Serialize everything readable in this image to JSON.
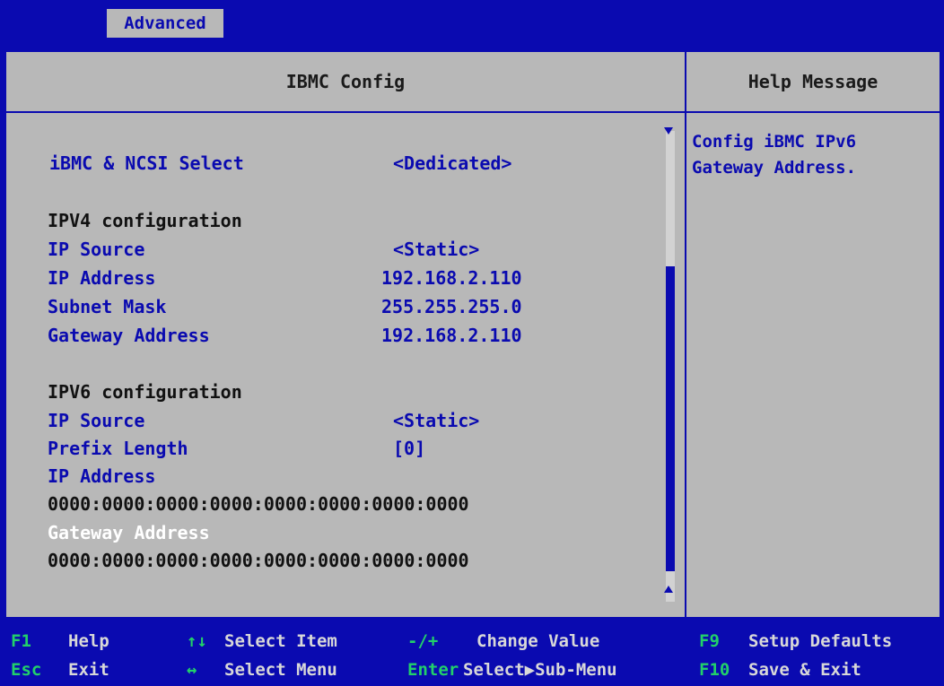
{
  "topbar": {
    "active_tab": "Advanced"
  },
  "panel": {
    "title": "IBMC Config",
    "help_title": "Help Message"
  },
  "items": [
    {
      "label": "iBMC & NCSI Select",
      "value": "<Dedicated>"
    },
    {
      "label": "IPV4 configuration",
      "value": ""
    },
    {
      "label": "IP Source",
      "value": "<Static>"
    },
    {
      "label": "IP Address",
      "value": "192.168.2.110"
    },
    {
      "label": "Subnet Mask",
      "value": "255.255.255.0"
    },
    {
      "label": "Gateway Address",
      "value": "192.168.2.110"
    },
    {
      "label": "IPV6 configuration",
      "value": ""
    },
    {
      "label": "IP Source",
      "value": "<Static>"
    },
    {
      "label": "Prefix Length",
      "value": "[0]"
    },
    {
      "label": "IP Address",
      "value": ""
    },
    {
      "label": "0000:0000:0000:0000:0000:0000:0000:0000",
      "value": ""
    },
    {
      "label": "Gateway Address",
      "value": ""
    },
    {
      "label": "0000:0000:0000:0000:0000:0000:0000:0000",
      "value": ""
    }
  ],
  "help": {
    "text": "Config iBMC IPv6\nGateway Address."
  },
  "footer": {
    "keys": [
      {
        "key": "F1",
        "desc": "Help"
      },
      {
        "key": "Esc",
        "desc": "Exit"
      },
      {
        "key": "↑↓",
        "desc": "Select Item"
      },
      {
        "key": "↔",
        "desc": "Select Menu"
      },
      {
        "key": "-/+",
        "desc": "Change Value"
      },
      {
        "key": "Enter",
        "desc": "Select▶Sub-Menu"
      },
      {
        "key": "F9",
        "desc": "Setup Defaults"
      },
      {
        "key": "F10",
        "desc": "Save & Exit"
      }
    ]
  },
  "colors": {
    "background": "#0a0ab0",
    "panel": "#b8b8b8",
    "item_blue": "#0a0ab0",
    "highlight": "#ffffff",
    "key_green": "#22d06a"
  }
}
